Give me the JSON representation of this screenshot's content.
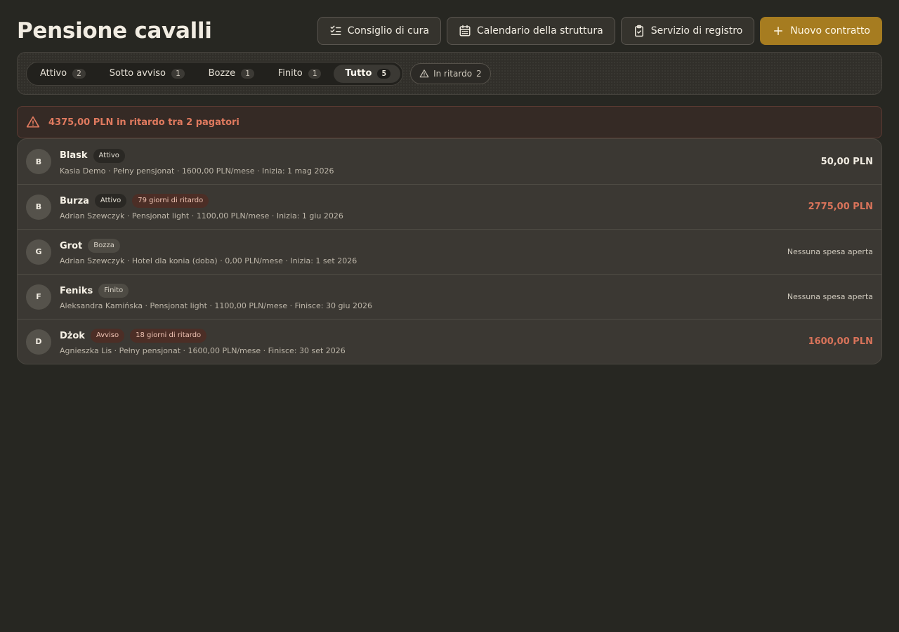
{
  "header": {
    "title": "Pensione cavalli",
    "buttons": {
      "care": "Consiglio di cura",
      "calendar": "Calendario della struttura",
      "registry": "Servizio di registro",
      "new_contract": "Nuovo contratto"
    }
  },
  "filters": {
    "tabs": [
      {
        "label": "Attivo",
        "count": "2"
      },
      {
        "label": "Sotto avviso",
        "count": "1"
      },
      {
        "label": "Bozze",
        "count": "1"
      },
      {
        "label": "Finito",
        "count": "1"
      },
      {
        "label": "Tutto",
        "count": "5"
      }
    ],
    "active_tab": "Tutto",
    "late_chip": {
      "label": "In ritardo",
      "count": "2"
    }
  },
  "alert": {
    "text": "4375,00 PLN in ritardo tra 2 pagatori"
  },
  "contracts": [
    {
      "initial": "B",
      "horse": "Blask",
      "status": "Attivo",
      "late": "",
      "details": "Kasia Demo · Pełny pensjonat · 1600,00 PLN/mese · Inizia: 1 mag 2026",
      "amount": "50,00 PLN"
    },
    {
      "initial": "B",
      "horse": "Burza",
      "status": "Attivo",
      "late": "79 giorni di ritardo",
      "details": "Adrian Szewczyk · Pensjonat light · 1100,00 PLN/mese · Inizia: 1 giu 2026",
      "amount": "2775,00 PLN"
    },
    {
      "initial": "G",
      "horse": "Grot",
      "status": "Bozza",
      "late": "",
      "details": "Adrian Szewczyk · Hotel dla konia (doba) · 0,00 PLN/mese · Inizia: 1 set 2026",
      "amount": "Nessuna spesa aperta"
    },
    {
      "initial": "F",
      "horse": "Feniks",
      "status": "Finito",
      "late": "",
      "details": "Aleksandra Kamińska · Pensjonat light · 1100,00 PLN/mese · Finisce: 30 giu 2026",
      "amount": "Nessuna spesa aperta"
    },
    {
      "initial": "D",
      "horse": "Dżok",
      "status": "Avviso",
      "late": "18 giorni di ritardo",
      "details": "Agnieszka Lis · Pełny pensjonat · 1600,00 PLN/mese · Finisce: 30 set 2026",
      "amount": "1600,00 PLN"
    }
  ],
  "colors": {
    "background": "#272722",
    "accent": "#a67c20",
    "overdue": "#d9735a"
  }
}
